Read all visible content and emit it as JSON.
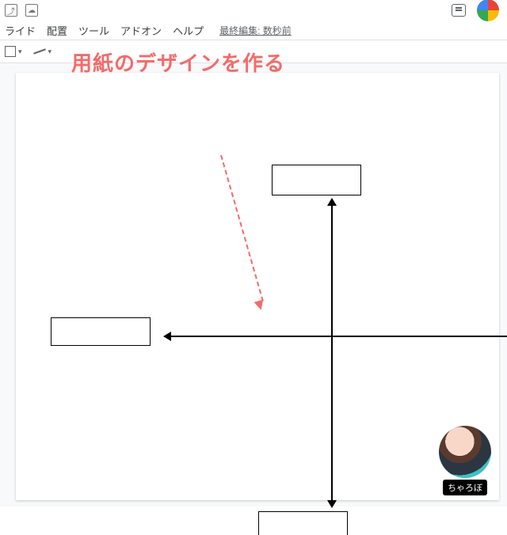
{
  "titlebar": {
    "move_icon_title": "⤴",
    "cloud_icon_title": "☁"
  },
  "menu": {
    "slide": "ライド",
    "arrange": "配置",
    "tools": "ツール",
    "addons": "アドオン",
    "help": "ヘルプ",
    "last_edit": "最終編集: 数秒前"
  },
  "callout": "用紙のデザインを作る",
  "mascot": {
    "name": "ちゃろぼ"
  }
}
